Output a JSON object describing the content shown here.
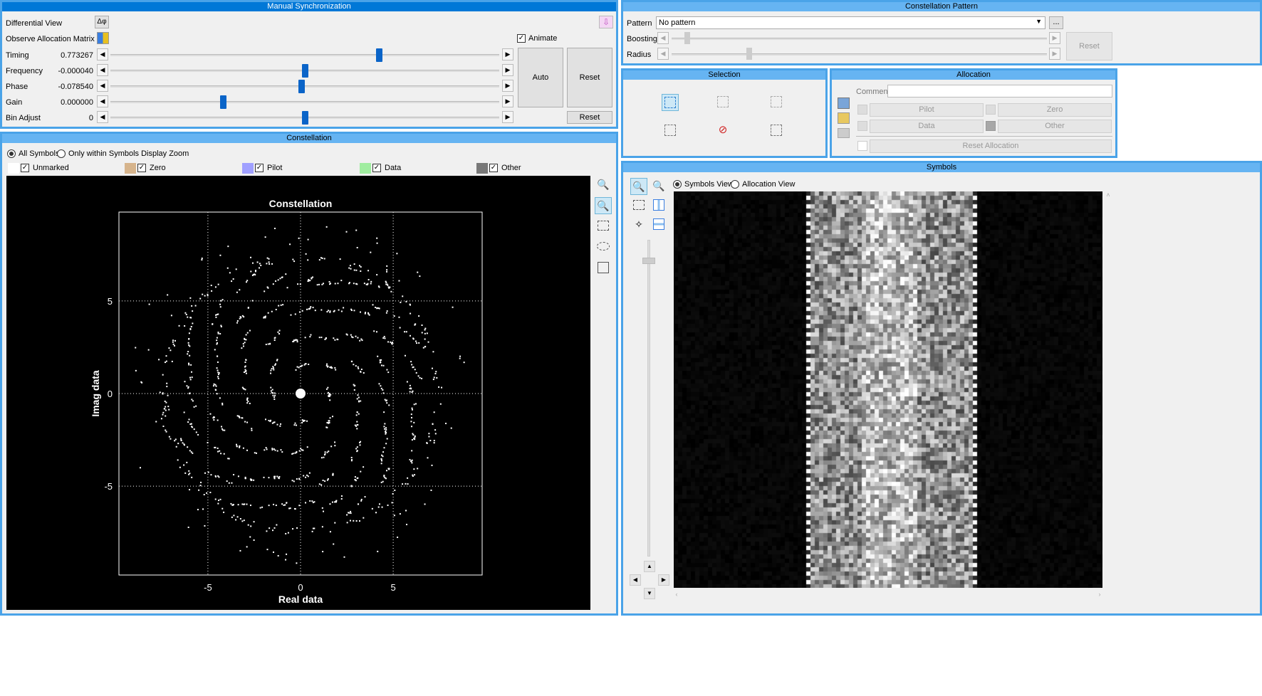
{
  "manual_sync": {
    "title": "Manual Synchronization",
    "differential_view": {
      "label": "Differential View",
      "button": "Δφ"
    },
    "observe_label": "Observe Allocation Matrix",
    "animate_label": "Animate",
    "animate_checked": true,
    "sliders": [
      {
        "label": "Timing",
        "value": "0.773267",
        "position": 0.69
      },
      {
        "label": "Frequency",
        "value": "-0.000040",
        "position": 0.5
      },
      {
        "label": "Phase",
        "value": "-0.078540",
        "position": 0.49
      },
      {
        "label": "Gain",
        "value": "0.000000",
        "position": 0.29
      },
      {
        "label": "Bin Adjust",
        "value": "0",
        "position": 0.5
      }
    ],
    "auto_label": "Auto",
    "reset_label": "Reset",
    "bin_reset_label": "Reset"
  },
  "constellation_panel": {
    "title": "Constellation",
    "radio_all": "All Symbols",
    "radio_zoom": "Only within Symbols Display Zoom",
    "legend": [
      {
        "label": "Unmarked",
        "color": "#ffffff",
        "checked": true
      },
      {
        "label": "Zero",
        "color": "#d6b48c",
        "checked": true
      },
      {
        "label": "Pilot",
        "color": "#a0a0ff",
        "checked": true
      },
      {
        "label": "Data",
        "color": "#a0eda0",
        "checked": true
      },
      {
        "label": "Other",
        "color": "#787878",
        "checked": true
      }
    ],
    "plot_title": "Constellation",
    "xlabel": "Real data",
    "ylabel": "Imag data",
    "x_ticks": [
      "-5",
      "0",
      "5"
    ],
    "y_ticks": [
      "5",
      "0",
      "-5"
    ]
  },
  "constellation_pattern": {
    "title": "Constellation Pattern",
    "pattern_label": "Pattern",
    "pattern_value": "No pattern",
    "more_button": "...",
    "boosting_label": "Boosting",
    "radius_label": "Radius",
    "reset_label": "Reset"
  },
  "selection": {
    "title": "Selection"
  },
  "allocation": {
    "title": "Allocation",
    "comment_label": "Comment",
    "comment_value": "",
    "pilot": "Pilot",
    "zero": "Zero",
    "data": "Data",
    "other": "Other",
    "reset_allocation": "Reset Allocation"
  },
  "symbols": {
    "title": "Symbols",
    "radio_symbols": "Symbols View",
    "radio_allocation": "Allocation View"
  },
  "chart_data": {
    "type": "scatter",
    "title": "Constellation",
    "xlabel": "Real data",
    "ylabel": "Imag data",
    "xlim": [
      -9.8,
      9.8
    ],
    "ylim": [
      -9.8,
      9.8
    ],
    "grid": true,
    "x_ticks": [
      -5,
      0,
      5
    ],
    "y_ticks": [
      -5,
      0,
      5
    ],
    "grid_levels": [
      -6,
      -4.5,
      -3,
      -1.5,
      0,
      1.5,
      3,
      4.5,
      6
    ],
    "outer_ring_radius": 7.4,
    "center_point": [
      0,
      0
    ]
  }
}
